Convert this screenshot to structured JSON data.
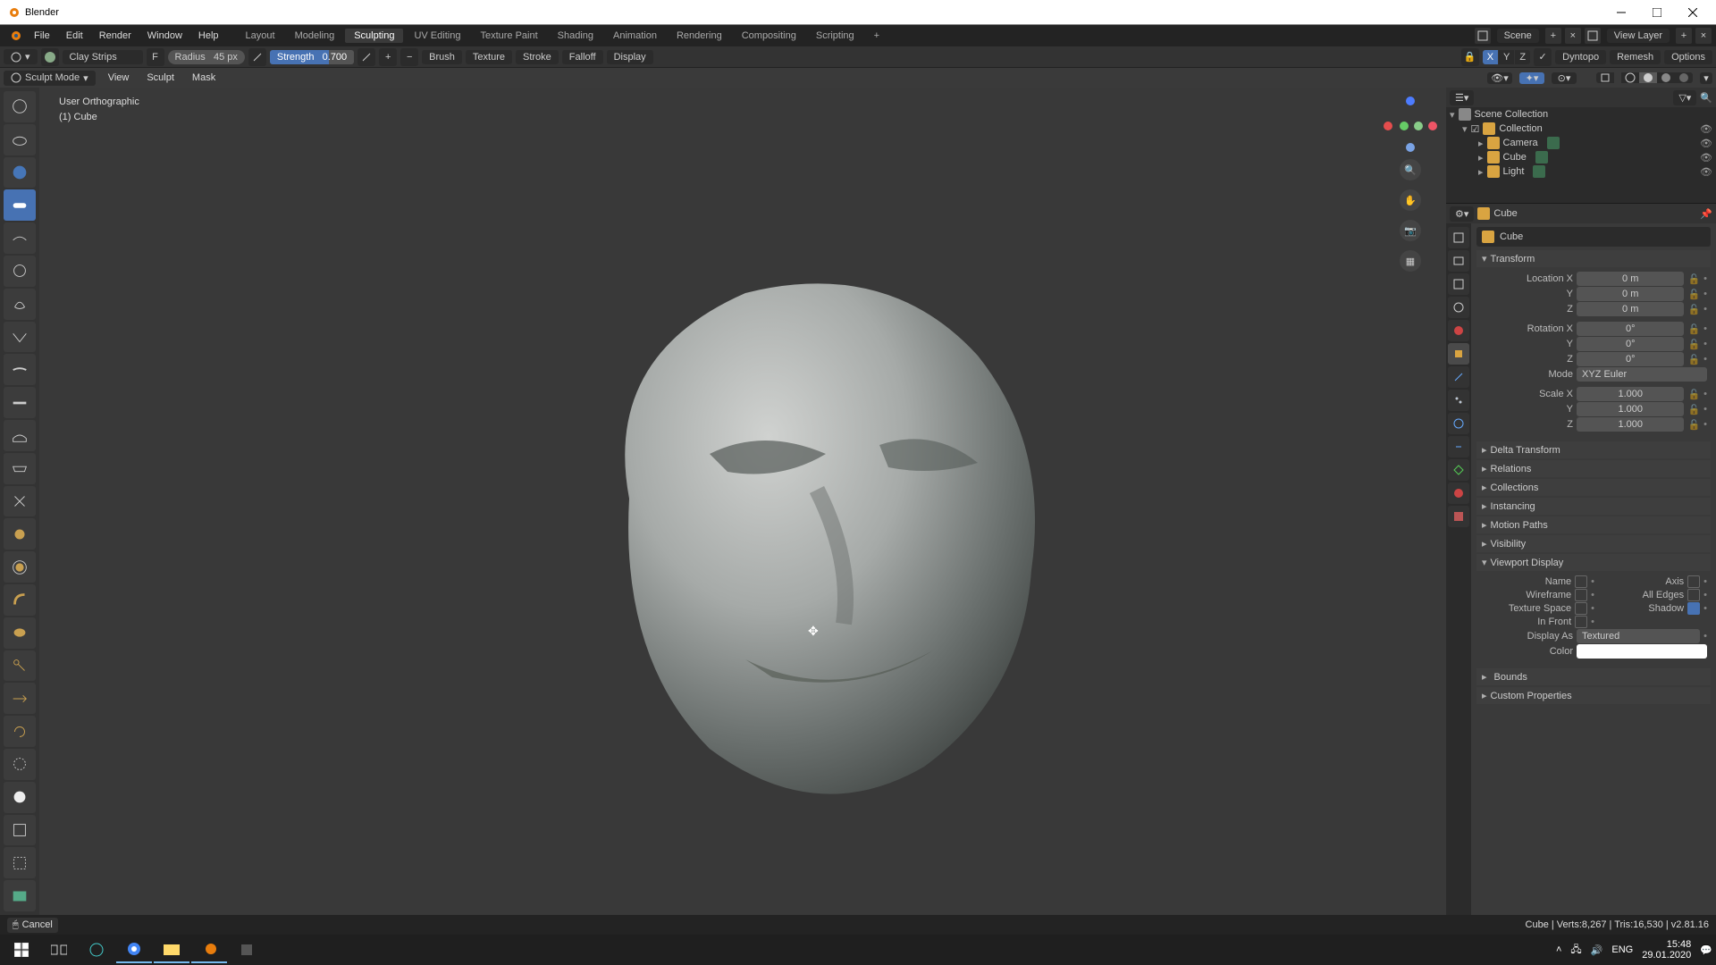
{
  "window": {
    "title": "Blender"
  },
  "menu": {
    "file": "File",
    "edit": "Edit",
    "render": "Render",
    "window": "Window",
    "help": "Help"
  },
  "workspaces": [
    "Layout",
    "Modeling",
    "Sculpting",
    "UV Editing",
    "Texture Paint",
    "Shading",
    "Animation",
    "Rendering",
    "Compositing",
    "Scripting"
  ],
  "workspace_active": "Sculpting",
  "scene": {
    "scene_label": "Scene",
    "viewlayer_label": "View Layer"
  },
  "toolheader": {
    "brush": "Clay Strips",
    "radius_label": "Radius",
    "radius_value": "45 px",
    "strength_label": "Strength",
    "strength_value": "0.700",
    "menus": {
      "brush": "Brush",
      "texture": "Texture",
      "stroke": "Stroke",
      "falloff": "Falloff",
      "display": "Display"
    },
    "mirror_axes": {
      "x": "X",
      "y": "Y",
      "z": "Z",
      "x_on": true,
      "y_on": false,
      "z_on": false
    },
    "dyntopo": "Dyntopo",
    "remesh": "Remesh",
    "options": "Options"
  },
  "subheader": {
    "mode": "Sculpt Mode",
    "view": "View",
    "sculpt": "Sculpt",
    "mask": "Mask"
  },
  "viewport": {
    "projection": "User Orthographic",
    "object": "(1) Cube"
  },
  "outliner": {
    "root": "Scene Collection",
    "collection": "Collection",
    "items": [
      "Camera",
      "Cube",
      "Light"
    ]
  },
  "properties": {
    "obj_name": "Cube",
    "data_name": "Cube",
    "transform": {
      "title": "Transform",
      "location_label": "Location X",
      "rotation_label": "Rotation X",
      "scale_label": "Scale X",
      "y": "Y",
      "z": "Z",
      "loc": [
        "0 m",
        "0 m",
        "0 m"
      ],
      "rot": [
        "0°",
        "0°",
        "0°"
      ],
      "scale": [
        "1.000",
        "1.000",
        "1.000"
      ],
      "mode_label": "Mode",
      "mode_value": "XYZ Euler"
    },
    "panels": {
      "delta": "Delta Transform",
      "relations": "Relations",
      "collections": "Collections",
      "instancing": "Instancing",
      "motion": "Motion Paths",
      "visibility": "Visibility",
      "viewport_display": "Viewport Display",
      "bounds": "Bounds",
      "custom": "Custom Properties"
    },
    "viewportdisp": {
      "name": "Name",
      "axis": "Axis",
      "wireframe": "Wireframe",
      "alledges": "All Edges",
      "texspace": "Texture Space",
      "shadow": "Shadow",
      "infront": "In Front",
      "displayas_label": "Display As",
      "displayas_value": "Textured",
      "color_label": "Color"
    }
  },
  "statusbar": {
    "cancel": "Cancel",
    "stats": "Cube | Verts:8,267 | Tris:16,530 | v2.81.16"
  },
  "taskbar": {
    "lang": "ENG",
    "time": "15:48",
    "date": "29.01.2020"
  }
}
